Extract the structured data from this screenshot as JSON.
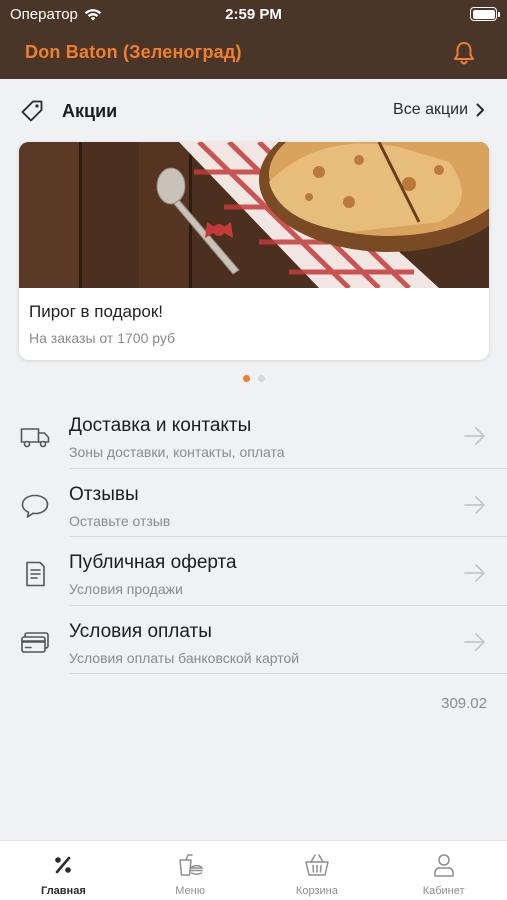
{
  "status_bar": {
    "carrier": "Оператор",
    "time": "2:59 PM"
  },
  "header": {
    "title": "Don Baton (Зеленоград)",
    "icon": "bell-icon"
  },
  "promos": {
    "title": "Акции",
    "all_label": "Все акции",
    "card": {
      "name": "Пирог в подарок!",
      "condition": "На заказы от 1700 руб"
    }
  },
  "menu": {
    "items": [
      {
        "title": "Доставка и контакты",
        "subtitle": "Зоны доставки, контакты, оплата",
        "icon": "truck-icon"
      },
      {
        "title": "Отзывы",
        "subtitle": "Оставьте отзыв",
        "icon": "speech-bubble-icon"
      },
      {
        "title": "Публичная оферта",
        "subtitle": "Условия продажи",
        "icon": "document-icon"
      },
      {
        "title": "Условия оплаты",
        "subtitle": "Условия оплаты банковской картой",
        "icon": "card-icon"
      }
    ]
  },
  "version": "309.02",
  "tabbar": {
    "tabs": [
      {
        "label": "Главная",
        "icon": "percent-icon",
        "active": true
      },
      {
        "label": "Меню",
        "icon": "food-icon",
        "active": false
      },
      {
        "label": "Корзина",
        "icon": "basket-icon",
        "active": false
      },
      {
        "label": "Кабинет",
        "icon": "person-icon",
        "active": false
      }
    ]
  },
  "colors": {
    "accent": "#f07f2d",
    "header_bg": "#4a3628"
  }
}
